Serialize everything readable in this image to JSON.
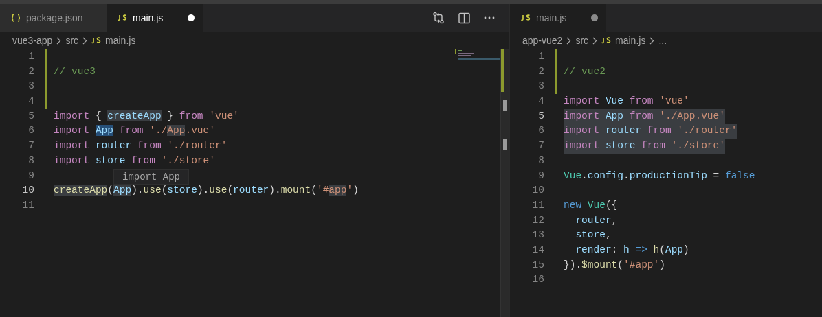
{
  "editor_groups": [
    {
      "focused": true,
      "show_actions": true,
      "tabs": [
        {
          "kind": "json",
          "label": "package.json",
          "selected": false,
          "dirty": false
        },
        {
          "kind": "js",
          "label": "main.js",
          "selected": true,
          "dirty": true
        }
      ],
      "breadcrumb": [
        {
          "kind": "folder",
          "text": "vue3-app"
        },
        {
          "kind": "folder",
          "text": "src"
        },
        {
          "kind": "js",
          "text": "main.js"
        }
      ],
      "hover": {
        "text": "import App"
      },
      "lines": [
        {
          "number": "1",
          "changed": true,
          "current": false,
          "selected": false
        },
        {
          "number": "2",
          "changed": true,
          "current": false,
          "selected": false,
          "tokens": [
            {
              "text": "// vue3",
              "kind": "comment"
            }
          ]
        },
        {
          "number": "3",
          "changed": true,
          "current": false,
          "selected": false
        },
        {
          "number": "4",
          "changed": true,
          "current": false,
          "selected": false
        },
        {
          "number": "5",
          "changed": false,
          "current": false,
          "selected": false,
          "tokens": [
            {
              "text": "import",
              "kind": "keyword"
            },
            {
              "text": " { ",
              "kind": "plain"
            },
            {
              "text": "createApp",
              "kind": "variable",
              "matched": true
            },
            {
              "text": " } ",
              "kind": "plain"
            },
            {
              "text": "from ",
              "kind": "keyword"
            },
            {
              "text": "'vue'",
              "kind": "string"
            }
          ]
        },
        {
          "number": "6",
          "changed": false,
          "current": false,
          "selected": false,
          "tokens": [
            {
              "text": "import ",
              "kind": "keyword"
            },
            {
              "text": "App",
              "kind": "variable",
              "selected": true
            },
            {
              "text": " from ",
              "kind": "keyword"
            },
            {
              "text": "'./",
              "kind": "string"
            },
            {
              "text": "App",
              "kind": "string",
              "matched": true
            },
            {
              "text": ".vue'",
              "kind": "string"
            }
          ]
        },
        {
          "number": "7",
          "changed": false,
          "current": false,
          "selected": false,
          "tokens": [
            {
              "text": "import ",
              "kind": "keyword"
            },
            {
              "text": "router ",
              "kind": "variable"
            },
            {
              "text": "from ",
              "kind": "keyword"
            },
            {
              "text": "'./router'",
              "kind": "string"
            }
          ]
        },
        {
          "number": "8",
          "changed": false,
          "current": false,
          "selected": false,
          "tokens": [
            {
              "text": "import ",
              "kind": "keyword"
            },
            {
              "text": "store ",
              "kind": "variable"
            },
            {
              "text": "from ",
              "kind": "keyword"
            },
            {
              "text": "'./store'",
              "kind": "string"
            }
          ]
        },
        {
          "number": "9",
          "changed": false,
          "current": false,
          "selected": false
        },
        {
          "number": "10",
          "changed": false,
          "current": true,
          "selected": false,
          "tokens": [
            {
              "text": "createApp",
              "kind": "function",
              "matched": true
            },
            {
              "text": "(",
              "kind": "plain"
            },
            {
              "text": "App",
              "kind": "variable",
              "matched": true
            },
            {
              "text": ").",
              "kind": "plain"
            },
            {
              "text": "use",
              "kind": "function"
            },
            {
              "text": "(",
              "kind": "plain"
            },
            {
              "text": "store",
              "kind": "variable"
            },
            {
              "text": ").",
              "kind": "plain"
            },
            {
              "text": "use",
              "kind": "function"
            },
            {
              "text": "(",
              "kind": "plain"
            },
            {
              "text": "router",
              "kind": "variable"
            },
            {
              "text": ").",
              "kind": "plain"
            },
            {
              "text": "mount",
              "kind": "function"
            },
            {
              "text": "(",
              "kind": "plain"
            },
            {
              "text": "'#",
              "kind": "string"
            },
            {
              "text": "app",
              "kind": "string",
              "matched": true
            },
            {
              "text": "'",
              "kind": "string"
            },
            {
              "text": ")",
              "kind": "plain"
            }
          ]
        },
        {
          "number": "11",
          "changed": false,
          "current": false,
          "selected": false
        }
      ]
    },
    {
      "focused": false,
      "show_actions": false,
      "tabs": [
        {
          "kind": "js",
          "label": "main.js",
          "selected": true,
          "dirty": true
        }
      ],
      "breadcrumb": [
        {
          "kind": "folder",
          "text": "app-vue2"
        },
        {
          "kind": "folder",
          "text": "src"
        },
        {
          "kind": "js",
          "text": "main.js"
        },
        {
          "kind": "folder",
          "text": "..."
        }
      ],
      "lines": [
        {
          "number": "1",
          "changed": true,
          "current": false,
          "selected": false
        },
        {
          "number": "2",
          "changed": true,
          "current": false,
          "selected": false,
          "tokens": [
            {
              "text": "// vue2",
              "kind": "comment"
            }
          ]
        },
        {
          "number": "3",
          "changed": true,
          "current": false,
          "selected": false
        },
        {
          "number": "4",
          "changed": false,
          "current": false,
          "selected": false,
          "tokens": [
            {
              "text": "import ",
              "kind": "keyword"
            },
            {
              "text": "Vue ",
              "kind": "variable"
            },
            {
              "text": "from ",
              "kind": "keyword"
            },
            {
              "text": "'vue'",
              "kind": "string"
            }
          ]
        },
        {
          "number": "5",
          "changed": false,
          "current": true,
          "selected": true,
          "tokens": [
            {
              "text": "import ",
              "kind": "keyword"
            },
            {
              "text": "App ",
              "kind": "variable"
            },
            {
              "text": "from ",
              "kind": "keyword"
            },
            {
              "text": "'./App.vue'",
              "kind": "string"
            }
          ]
        },
        {
          "number": "6",
          "changed": false,
          "current": false,
          "selected": true,
          "tokens": [
            {
              "text": "import ",
              "kind": "keyword"
            },
            {
              "text": "router ",
              "kind": "variable"
            },
            {
              "text": "from ",
              "kind": "keyword"
            },
            {
              "text": "'./router'",
              "kind": "string"
            }
          ]
        },
        {
          "number": "7",
          "changed": false,
          "current": false,
          "selected": true,
          "tokens": [
            {
              "text": "import ",
              "kind": "keyword"
            },
            {
              "text": "store ",
              "kind": "variable"
            },
            {
              "text": "from ",
              "kind": "keyword"
            },
            {
              "text": "'./store'",
              "kind": "string"
            }
          ]
        },
        {
          "number": "8",
          "changed": false,
          "current": false,
          "selected": false
        },
        {
          "number": "9",
          "changed": false,
          "current": false,
          "selected": false,
          "tokens": [
            {
              "text": "Vue",
              "kind": "class"
            },
            {
              "text": ".",
              "kind": "plain"
            },
            {
              "text": "config",
              "kind": "variable"
            },
            {
              "text": ".",
              "kind": "plain"
            },
            {
              "text": "productionTip",
              "kind": "variable"
            },
            {
              "text": " = ",
              "kind": "plain"
            },
            {
              "text": "false",
              "kind": "storage"
            }
          ]
        },
        {
          "number": "10",
          "changed": false,
          "current": false,
          "selected": false
        },
        {
          "number": "11",
          "changed": false,
          "current": false,
          "selected": false,
          "tokens": [
            {
              "text": "new ",
              "kind": "storage"
            },
            {
              "text": "Vue",
              "kind": "class"
            },
            {
              "text": "({",
              "kind": "plain"
            }
          ]
        },
        {
          "number": "12",
          "changed": false,
          "current": false,
          "selected": false,
          "tokens": [
            {
              "text": "  router",
              "kind": "variable"
            },
            {
              "text": ",",
              "kind": "plain"
            }
          ]
        },
        {
          "number": "13",
          "changed": false,
          "current": false,
          "selected": false,
          "tokens": [
            {
              "text": "  store",
              "kind": "variable"
            },
            {
              "text": ",",
              "kind": "plain"
            }
          ]
        },
        {
          "number": "14",
          "changed": false,
          "current": false,
          "selected": false,
          "tokens": [
            {
              "text": "  render",
              "kind": "variable"
            },
            {
              "text": ": ",
              "kind": "plain"
            },
            {
              "text": "h ",
              "kind": "variable"
            },
            {
              "text": "=> ",
              "kind": "storage"
            },
            {
              "text": "h",
              "kind": "function"
            },
            {
              "text": "(",
              "kind": "plain"
            },
            {
              "text": "App",
              "kind": "variable"
            },
            {
              "text": ")",
              "kind": "plain"
            }
          ]
        },
        {
          "number": "15",
          "changed": false,
          "current": false,
          "selected": false,
          "tokens": [
            {
              "text": "}).",
              "kind": "plain"
            },
            {
              "text": "$mount",
              "kind": "function"
            },
            {
              "text": "(",
              "kind": "plain"
            },
            {
              "text": "'#app'",
              "kind": "string"
            },
            {
              "text": ")",
              "kind": "plain"
            }
          ]
        },
        {
          "number": "16",
          "changed": false,
          "current": false,
          "selected": false
        }
      ]
    }
  ]
}
